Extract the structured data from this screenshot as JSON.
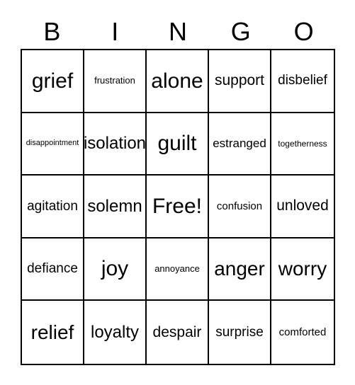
{
  "card": {
    "title": "BINGO",
    "headers": [
      "B",
      "I",
      "N",
      "G",
      "O"
    ],
    "free_space_label": "Free!",
    "colors": {
      "background": "#ffffff",
      "border": "#000000",
      "text": "#000000"
    },
    "grid": {
      "columns": 5,
      "rows": 5
    },
    "rows": [
      [
        {
          "label": "grief",
          "size": "s-hu"
        },
        {
          "label": "frustration",
          "size": "s-sm2"
        },
        {
          "label": "alone",
          "size": "s-hu"
        },
        {
          "label": "support",
          "size": "s-lg2"
        },
        {
          "label": "disbelief",
          "size": "s-lg"
        }
      ],
      [
        {
          "label": "disappointment",
          "size": "s-xs"
        },
        {
          "label": "isolation",
          "size": "s-xl"
        },
        {
          "label": "guilt",
          "size": "s-hu"
        },
        {
          "label": "estranged",
          "size": "s-md2"
        },
        {
          "label": "togetherness",
          "size": "s-sm"
        }
      ],
      [
        {
          "label": "agitation",
          "size": "s-lg"
        },
        {
          "label": "solemn",
          "size": "s-xl"
        },
        {
          "label": "Free!",
          "size": "s-hu"
        },
        {
          "label": "confusion",
          "size": "s-md"
        },
        {
          "label": "unloved",
          "size": "s-lg2"
        }
      ],
      [
        {
          "label": "defiance",
          "size": "s-lg"
        },
        {
          "label": "joy",
          "size": "s-hu"
        },
        {
          "label": "annoyance",
          "size": "s-sm2"
        },
        {
          "label": "anger",
          "size": "s-xxl"
        },
        {
          "label": "worry",
          "size": "s-xxl"
        }
      ],
      [
        {
          "label": "relief",
          "size": "s-xxl"
        },
        {
          "label": "loyalty",
          "size": "s-xl"
        },
        {
          "label": "despair",
          "size": "s-lg2"
        },
        {
          "label": "surprise",
          "size": "s-lg"
        },
        {
          "label": "comforted",
          "size": "s-md"
        }
      ]
    ]
  }
}
